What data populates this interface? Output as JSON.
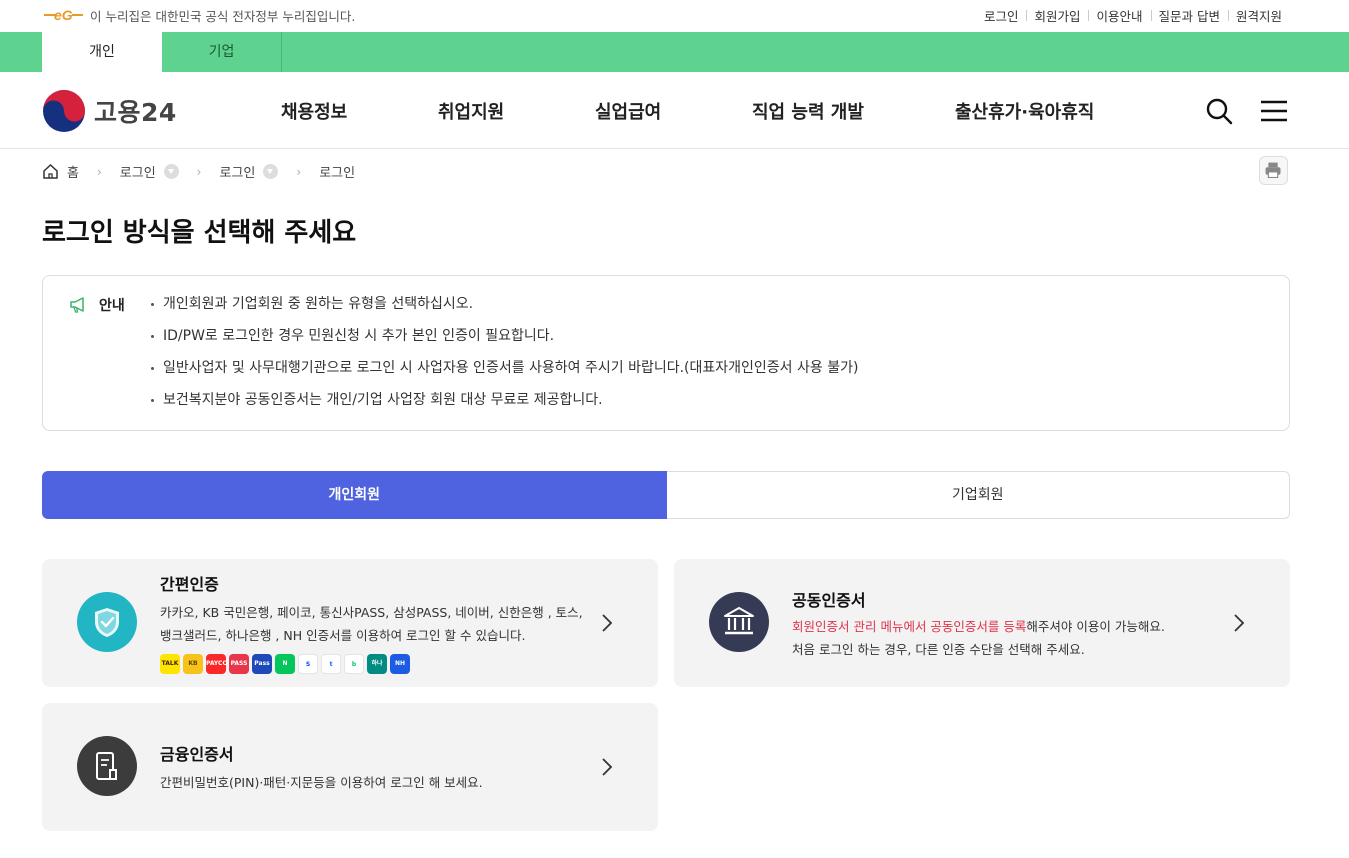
{
  "util": {
    "gov_notice": "이 누리집은 대한민국 공식 전자정부 누리집입니다.",
    "links": [
      "로그인",
      "회원가입",
      "이용안내",
      "질문과 답변",
      "원격지원"
    ]
  },
  "strip_tabs": {
    "personal": "개인",
    "company": "기업"
  },
  "header": {
    "logo_text": "고용24",
    "nav": [
      "채용정보",
      "취업지원",
      "실업급여",
      "직업 능력 개발",
      "출산휴가·육아휴직"
    ],
    "search_icon": "search-icon",
    "menu_icon": "hamburger-menu-icon"
  },
  "breadcrumb": {
    "home": "홈",
    "level1": "로그인",
    "level2": "로그인",
    "current": "로그인"
  },
  "page_title": "로그인 방식을 선택해 주세요",
  "notice": {
    "label": "안내",
    "items": [
      "개인회원과 기업회원 중 원하는 유형을 선택하십시오.",
      "ID/PW로 로그인한 경우 민원신청 시 추가 본인 인증이 필요합니다.",
      "일반사업자 및 사무대행기관으로 로그인 시 사업자용 인증서를 사용하여 주시기 바랍니다.(대표자개인인증서 사용 불가)",
      "보건복지분야 공동인증서는 개인/기업 사업장 회원 대상 무료로 제공합니다."
    ]
  },
  "member_tabs": {
    "personal": "개인회원",
    "company": "기업회원"
  },
  "cards": {
    "simple": {
      "title": "간편인증",
      "desc1": "카카오, KB 국민은행, 페이코, 통신사PASS, 삼성PASS, 네이버, 신한은행 , 토스,",
      "desc2": "뱅크샐러드, 하나은행 , NH 인증서를 이용하여 로그인 할 수 있습니다.",
      "icon": "shield-check-icon"
    },
    "joint": {
      "title": "공동인증서",
      "desc_red": "회원인증서 관리 메뉴에서 공동인증서를 등록",
      "desc_rest": "해주셔야 이용이 가능해요.",
      "desc2": "처음 로그인 하는 경우, 다른 인증 수단을 선택해 주세요.",
      "icon": "bank-building-icon"
    },
    "finance": {
      "title": "금융인증서",
      "desc": "간편비밀번호(PIN)·패턴·지문등을 이용하여 로그인 해 보세요.",
      "icon": "certificate-document-icon"
    }
  },
  "provider_badges": [
    {
      "name": "kakao",
      "color": "#fee500",
      "text": "TALK",
      "fg": "#3a1d1d"
    },
    {
      "name": "kb",
      "color": "#f9c21b",
      "text": "KB",
      "fg": "#5a4a00"
    },
    {
      "name": "payco",
      "color": "#fa2828",
      "text": "PAYCO",
      "fg": "#fff"
    },
    {
      "name": "pass",
      "color": "#e8364b",
      "text": "PASS",
      "fg": "#fff"
    },
    {
      "name": "samsung-pass",
      "color": "#1f48b8",
      "text": "Pass",
      "fg": "#fff"
    },
    {
      "name": "naver",
      "color": "#03c75a",
      "text": "N",
      "fg": "#fff"
    },
    {
      "name": "shinhan",
      "color": "#ffffff",
      "text": "S",
      "fg": "#0046ff"
    },
    {
      "name": "toss",
      "color": "#ffffff",
      "text": "t",
      "fg": "#0064ff"
    },
    {
      "name": "banksalad",
      "color": "#ffffff",
      "text": "b",
      "fg": "#00c96b"
    },
    {
      "name": "hana",
      "color": "#008c82",
      "text": "하나",
      "fg": "#fff"
    },
    {
      "name": "nh",
      "color": "#1b5ce3",
      "text": "NH",
      "fg": "#fff"
    }
  ],
  "colors": {
    "strip_green": "#5dd38f",
    "tab_blue": "#4f63e0",
    "shield_teal": "#22b5c4",
    "bank_navy": "#353b55",
    "finance_dark": "#3c3c3c",
    "alert_red": "#e0334a"
  }
}
